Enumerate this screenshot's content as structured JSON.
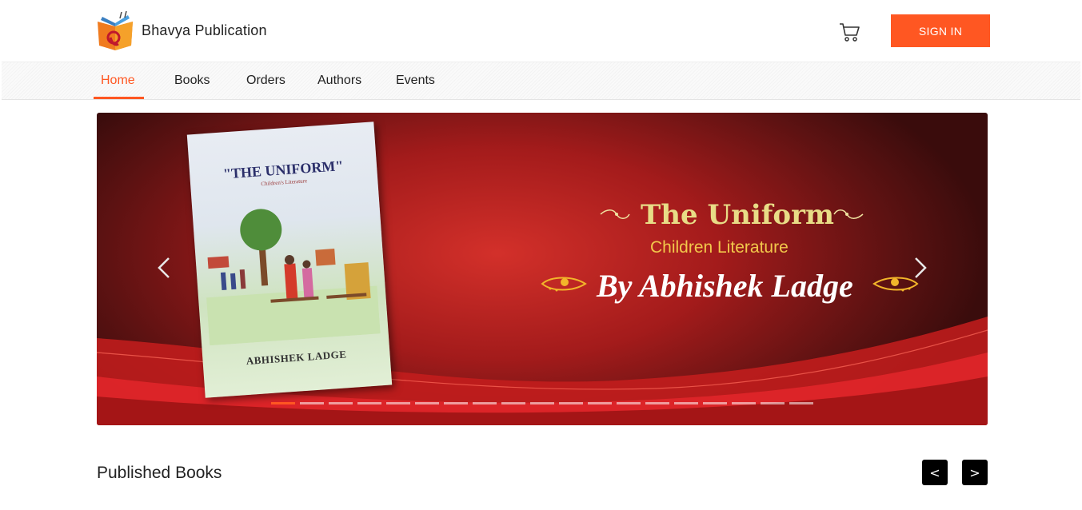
{
  "header": {
    "brand_name": "Bhavya Publication",
    "signin_label": "SIGN IN",
    "accent_color": "#ff5722"
  },
  "nav": {
    "items": [
      {
        "label": "Home",
        "active": true
      },
      {
        "label": "Books",
        "active": false
      },
      {
        "label": "Orders",
        "active": false
      },
      {
        "label": "Authors",
        "active": false
      },
      {
        "label": "Events",
        "active": false
      }
    ]
  },
  "carousel": {
    "slide": {
      "book_cover_title": "\"THE UNIFORM\"",
      "book_cover_subtitle": "Children's Literature",
      "book_cover_author": "ABHISHEK LADGE",
      "headline": "The Uniform",
      "subheadline": "Children Literature",
      "byline": "By Abhishek Ladge"
    },
    "slide_count": 19,
    "active_index": 0,
    "prev_icon": "chevron-left-icon",
    "next_icon": "chevron-right-icon"
  },
  "published": {
    "title": "Published Books",
    "prev_label": "<",
    "next_label": ">"
  }
}
